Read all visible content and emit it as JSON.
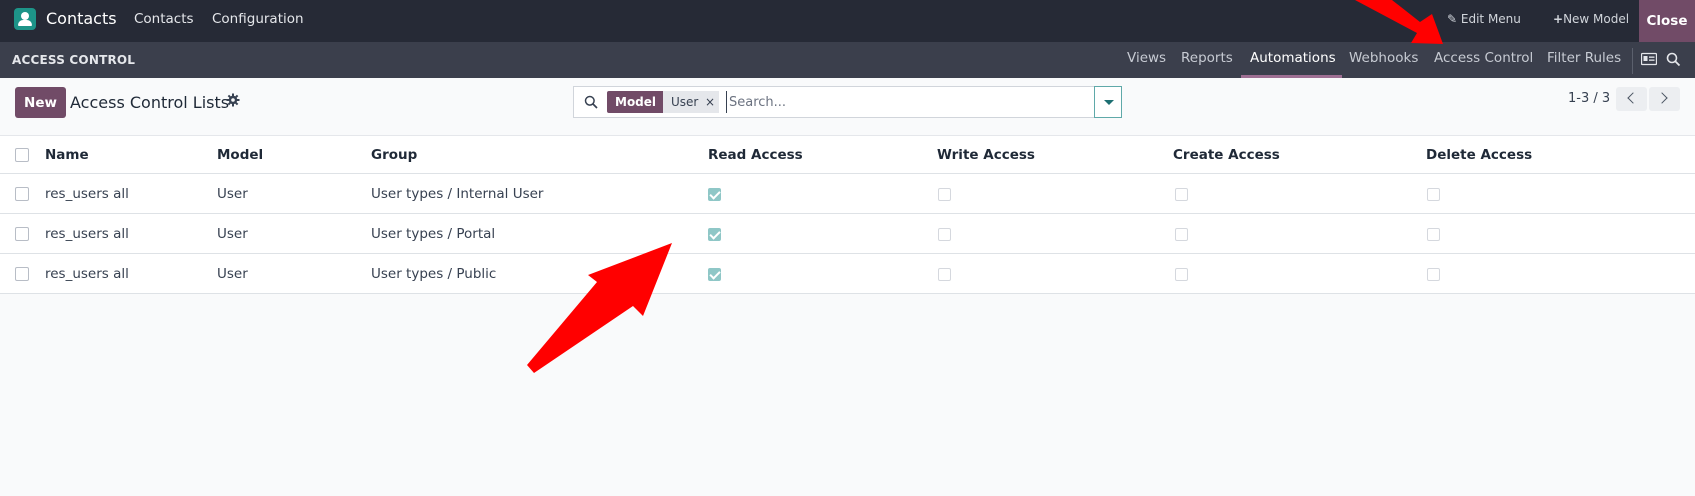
{
  "topbar": {
    "app_name": "Contacts",
    "menus": [
      "Contacts",
      "Configuration"
    ],
    "edit_menu": "Edit Menu",
    "new_model": "New Model",
    "close": "Close"
  },
  "studio": {
    "title": "ACCESS CONTROL",
    "tabs": [
      "Views",
      "Reports",
      "Automations",
      "Webhooks",
      "Access Control",
      "Filter Rules"
    ],
    "active_tab": "Automations"
  },
  "control_panel": {
    "new_button": "New",
    "breadcrumb": "Access Control Lists",
    "search": {
      "facet_label": "Model",
      "facet_value": "User",
      "remove": "×",
      "placeholder": "Search..."
    },
    "pager": "1-3 / 3"
  },
  "table": {
    "columns": [
      "Name",
      "Model",
      "Group",
      "Read Access",
      "Write Access",
      "Create Access",
      "Delete Access"
    ],
    "rows": [
      {
        "name": "res_users all",
        "model": "User",
        "group": "User types / Internal User",
        "read": true,
        "write": false,
        "create": false,
        "delete": false
      },
      {
        "name": "res_users all",
        "model": "User",
        "group": "User types / Portal",
        "read": true,
        "write": false,
        "create": false,
        "delete": false
      },
      {
        "name": "res_users all",
        "model": "User",
        "group": "User types / Public",
        "read": true,
        "write": false,
        "create": false,
        "delete": false
      }
    ]
  },
  "colors": {
    "navbar": "#262a36",
    "subbar": "#3b3f4c",
    "brand": "#714b67",
    "checkbox_checked": "#8fc7c7",
    "annotation_arrow": "#ff0000"
  },
  "icons": [
    "contacts-app-icon",
    "pencil-icon",
    "plus-icon",
    "search-icon",
    "cog-icon",
    "caret-down-icon",
    "chevron-left-icon",
    "chevron-right-icon",
    "id-card-icon",
    "close-x-icon"
  ]
}
